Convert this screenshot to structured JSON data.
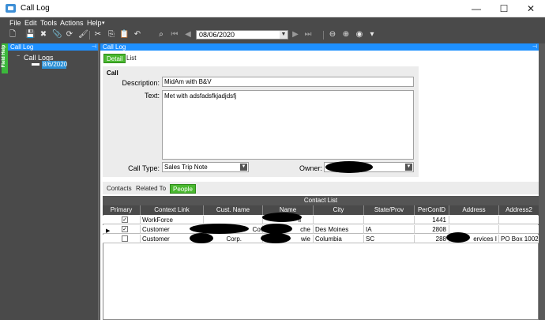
{
  "window": {
    "title": "Call Log",
    "minimize": "—",
    "maximize": "☐",
    "close": "✕"
  },
  "menu": [
    "File",
    "Edit",
    "Tools",
    "Actions",
    "Help"
  ],
  "toolbar": {
    "date": "08/06/2020"
  },
  "left_panel": {
    "header": "Call Log",
    "field_help": "Field Help",
    "tree_root": "Call Logs",
    "tree_child": "8/6/2020",
    "expander": "−"
  },
  "right_panel": {
    "header": "Call Log",
    "tabs": [
      "Detail",
      "List"
    ]
  },
  "call": {
    "group_title": "Call",
    "description_label": "Description:",
    "description_value": "MidAm with B&V",
    "text_label": "Text:",
    "text_value": "Met with adsfadsfkjadjdsfj",
    "call_type_label": "Call Type:",
    "call_type_value": "Sales Trip Note",
    "owner_label": "Owner:"
  },
  "lower_tabs": [
    "Contacts",
    "Related To",
    "People"
  ],
  "grid": {
    "title": "Contact List",
    "columns": [
      "Primary",
      "Context Link",
      "Cust. Name",
      "Name",
      "City",
      "State/Prov",
      "PerConID",
      "Address",
      "Address2"
    ],
    "rows": [
      {
        "primary": "✓",
        "context": "WorkForce",
        "cust": "",
        "name": "li",
        "city": "",
        "state": "",
        "perconid": "1441",
        "address": "",
        "address2": ""
      },
      {
        "primary": "✓",
        "context": "Customer",
        "cust": "Co.",
        "name": "che",
        "city": "Des Moines",
        "state": "IA",
        "perconid": "2808",
        "address": "",
        "address2": ""
      },
      {
        "primary": "",
        "context": "Customer",
        "cust": "Corp.",
        "name": "wie",
        "city": "Columbia",
        "state": "SC",
        "perconid": "288",
        "address": "ervices I",
        "address2": "PO Box 10025"
      }
    ]
  }
}
